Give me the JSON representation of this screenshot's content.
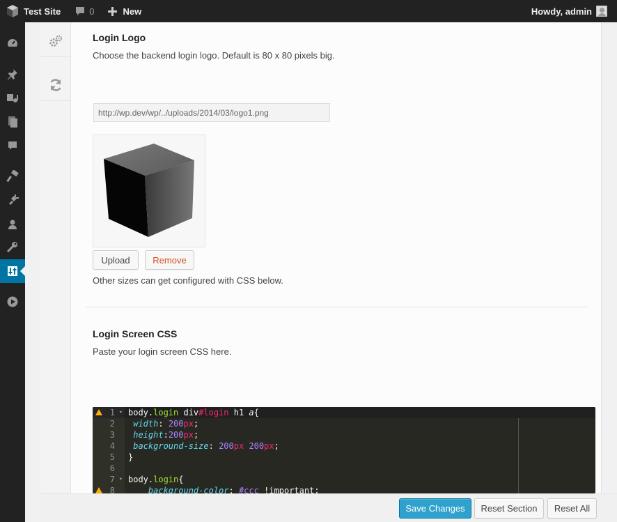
{
  "adminbar": {
    "site_name": "Test Site",
    "comments_count": "0",
    "new_label": "New",
    "greeting": "Howdy, admin"
  },
  "menu": {
    "items": [
      "dashboard-icon",
      "pin-icon",
      "media-icon",
      "pages-icon",
      "comments-icon",
      "appearance-icon",
      "plugins-icon",
      "users-icon",
      "tools-icon",
      "options-icon",
      "play-icon"
    ],
    "current": "options-icon"
  },
  "section_nav": [
    "gears-icon",
    "refresh-icon"
  ],
  "login_logo": {
    "title": "Login Logo",
    "description": "Choose the backend login logo. Default is 80 x 80 pixels big.",
    "url_value": "http://wp.dev/wp/../uploads/2014/03/logo1.png",
    "upload_label": "Upload",
    "remove_label": "Remove",
    "note": "Other sizes can get configured with CSS below."
  },
  "login_css": {
    "title": "Login Screen CSS",
    "description": "Paste your login screen CSS here."
  },
  "editor": {
    "line_numbers": [
      "1",
      "2",
      "3",
      "4",
      "5",
      "6",
      "7",
      "8"
    ],
    "lines": [
      "body.login div#login h1 a{",
      " width: 200px;",
      " height:200px;",
      " background-size: 200px 200px;",
      "}",
      "",
      "body.login{",
      "    background-color: #ccc !important;"
    ]
  },
  "footer": {
    "save_label": "Save Changes",
    "reset_section_label": "Reset Section",
    "reset_all_label": "Reset All"
  },
  "colors": {
    "adminbar_bg": "#222222",
    "menu_current": "#0074a2",
    "primary_button": "#2ea2cc",
    "remove_text": "#d54e21",
    "editor_bg": "#272822"
  }
}
